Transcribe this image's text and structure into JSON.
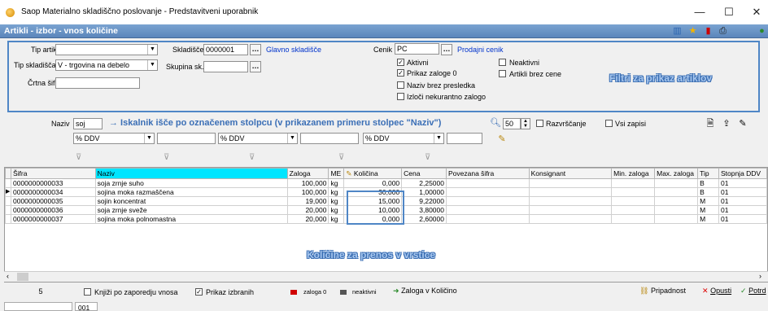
{
  "window": {
    "title": "Saop Materialno skladiščno poslovanje - Predstavitveni uporabnik",
    "min": "—",
    "max": "☐",
    "close": "✕"
  },
  "header": {
    "title": "Artikli - izbor - vnos količine"
  },
  "filters": {
    "tip_artikla_label": "Tip artikla",
    "tip_skladisca_label": "Tip skladišča",
    "tip_skladisca_value": "V - trgovina na debelo",
    "crtna_sifra_label": "Črtna šifra",
    "skladisce_label": "Skladišče",
    "skladisce_value": "0000001",
    "skladisce_name": "Glavno skladišče",
    "skupina_label": "Skupina sk.",
    "cenik_label": "Cenik",
    "cenik_value": "PC",
    "cenik_name": "Prodajni cenik",
    "checks": [
      {
        "label": "Aktivni",
        "checked": true
      },
      {
        "label": "Prikaz zaloge 0",
        "checked": true
      },
      {
        "label": "Naziv brez presledka",
        "checked": false
      },
      {
        "label": "Izloči nekurantno zalogo",
        "checked": false
      },
      {
        "label": "Neaktivni",
        "checked": false
      },
      {
        "label": "Artikli brez cene",
        "checked": false
      }
    ],
    "overlay": "Filtri za prikaz artiklov"
  },
  "search": {
    "naziv_label": "Naziv",
    "naziv_value": "soj",
    "annotation": "→ Iskalnik išče po označenem stolpcu (v prikazanem primeru stolpec \"Naziv\")",
    "count_value": "50",
    "razvrscanje_label": "Razvrščanje",
    "vsi_zapisi_label": "Vsi zapisi",
    "ddv": [
      "% DDV",
      "% DDV",
      "% DDV"
    ]
  },
  "grid": {
    "columns": [
      "Šifra",
      "Naziv",
      "Zaloga",
      "ME",
      "Količina",
      "Cena",
      "Povezana šifra",
      "Konsignant",
      "Min. zaloga",
      "Max. zaloga",
      "Tip",
      "Stopnja DDV"
    ],
    "rows": [
      {
        "sifra": "0000000000033",
        "naziv": "soja zrnje suho",
        "zaloga": "100,000",
        "me": "kg",
        "kolicina": "0,000",
        "cena": "2,25000",
        "tip": "B",
        "ddv": "01"
      },
      {
        "sifra": "0000000000034",
        "naziv": "sojina moka razmaščena",
        "zaloga": "100,000",
        "me": "kg",
        "kolicina": "30,000",
        "cena": "1,00000",
        "tip": "B",
        "ddv": "01"
      },
      {
        "sifra": "0000000000035",
        "naziv": "sojin koncentrat",
        "zaloga": "19,000",
        "me": "kg",
        "kolicina": "15,000",
        "cena": "9,22000",
        "tip": "M",
        "ddv": "01"
      },
      {
        "sifra": "0000000000036",
        "naziv": "soja zrnje sveže",
        "zaloga": "20,000",
        "me": "kg",
        "kolicina": "10,000",
        "cena": "3,80000",
        "tip": "M",
        "ddv": "01"
      },
      {
        "sifra": "0000000000037",
        "naziv": "sojina moka polnomastna",
        "zaloga": "20,000",
        "me": "kg",
        "kolicina": "0,000",
        "cena": "2,60000",
        "tip": "M",
        "ddv": "01"
      }
    ],
    "overlay": "Količine za prenos v vrstice"
  },
  "bottom": {
    "count": "5",
    "knjizi_label": "Knjiži po zaporedju vnosa",
    "prikaz_label": "Prikaz izbranih",
    "legend_zaloga": "zaloga 0",
    "legend_neaktivni": "neaktivni",
    "zaloga_v_kolicino": "Zaloga v Količino",
    "pripadnost": "Pripadnost",
    "opusti": "Opusti",
    "potrdi": "Potrd"
  },
  "status": {
    "code": "001"
  },
  "colors": {
    "accent": "#4f86c6",
    "header": "#5b86bb",
    "selected_col": "#00e5ff",
    "legend_red": "#d00000"
  }
}
